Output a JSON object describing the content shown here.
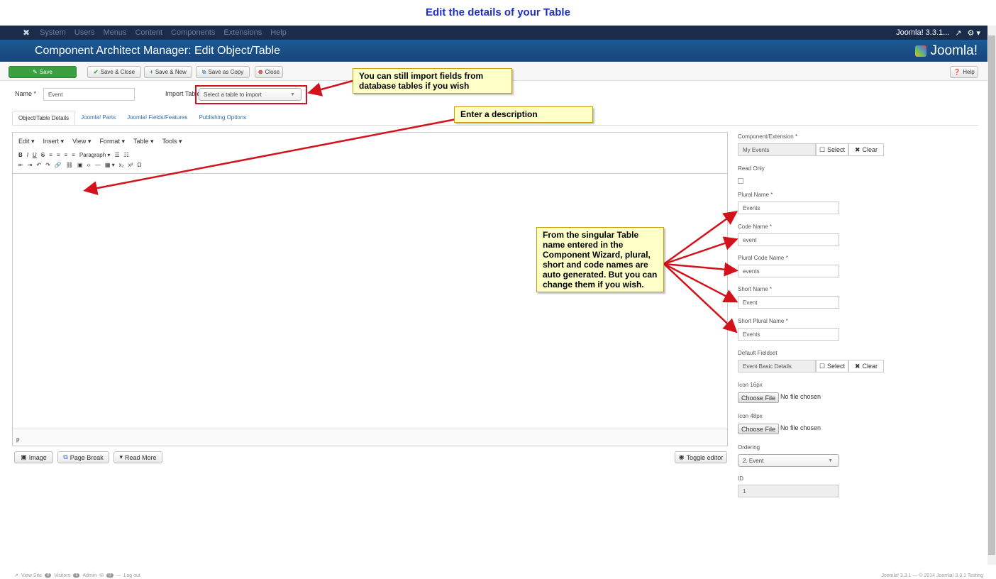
{
  "page_title": "Edit the details of your Table",
  "topnav": {
    "items": [
      "System",
      "Users",
      "Menus",
      "Content",
      "Components",
      "Extensions",
      "Help"
    ],
    "version": "Joomla! 3.3.1...",
    "external_glyph": "↗",
    "gear_glyph": "⚙ ▾"
  },
  "header": {
    "title": "Component Architect Manager: Edit Object/Table",
    "brand": "Joomla!"
  },
  "toolbar": {
    "save": "Save",
    "save_close": "Save & Close",
    "save_new": "Save & New",
    "save_copy": "Save as Copy",
    "close": "Close",
    "help": "Help"
  },
  "form": {
    "name_label": "Name *",
    "name_value": "Event",
    "import_label": "Import Table",
    "import_placeholder": "Select a table to import"
  },
  "tabs": [
    "Object/Table Details",
    "Joomla! Parts",
    "Joomla! Fields/Features",
    "Publishing Options"
  ],
  "editor": {
    "menus": [
      "Edit ▾",
      "Insert ▾",
      "View ▾",
      "Format ▾",
      "Table ▾",
      "Tools ▾"
    ],
    "toolbar_row1": [
      "B",
      "I",
      "U",
      "S",
      "≡",
      "≡",
      "≡",
      "≡",
      "Paragraph ▾",
      "☰",
      "☷"
    ],
    "toolbar_row2": [
      "⇤",
      "⇥",
      "↶",
      "↷",
      "🔗",
      "⛓",
      "▣",
      "‹›",
      "—",
      "▦ ▾",
      "x₂",
      "x²",
      "Ω"
    ],
    "status_path": "p",
    "buttons": {
      "image": "Image",
      "page_break": "Page Break",
      "read_more": "Read More",
      "toggle": "Toggle editor"
    }
  },
  "right_panel": {
    "component_label": "Component/Extension *",
    "component_value": "My Events",
    "select": "Select",
    "clear": "Clear",
    "read_only_label": "Read Only",
    "plural_name_label": "Plural Name *",
    "plural_name_value": "Events",
    "code_name_label": "Code Name *",
    "code_name_value": "event",
    "plural_code_label": "Plural Code Name *",
    "plural_code_value": "events",
    "short_name_label": "Short Name *",
    "short_name_value": "Event",
    "short_plural_label": "Short Plural Name *",
    "short_plural_value": "Events",
    "fieldset_label": "Default Fieldset",
    "fieldset_value": "Event Basic Details",
    "icon16_label": "Icon 16px",
    "icon48_label": "Icon 48px",
    "choose_file": "Choose File",
    "no_file": "No file chosen",
    "ordering_label": "Ordering",
    "ordering_value": "2. Event",
    "id_label": "ID",
    "id_value": "1"
  },
  "callouts": {
    "import": "You can still import fields from database tables if you wish",
    "description": "Enter a description",
    "names": "From the singular Table name entered in the Component Wizard, plural, short and code names are auto generated. But you can change them if you wish."
  },
  "footer": {
    "view_site": "View Site",
    "visitors_count": "0",
    "visitors": "Visitors",
    "admin_count": "1",
    "admin": "Admin",
    "msg_count": "0",
    "logout": "Log out",
    "copyright": "Joomla! 3.3.1 — © 2014 Joomla! 3.3.1 Testing"
  }
}
